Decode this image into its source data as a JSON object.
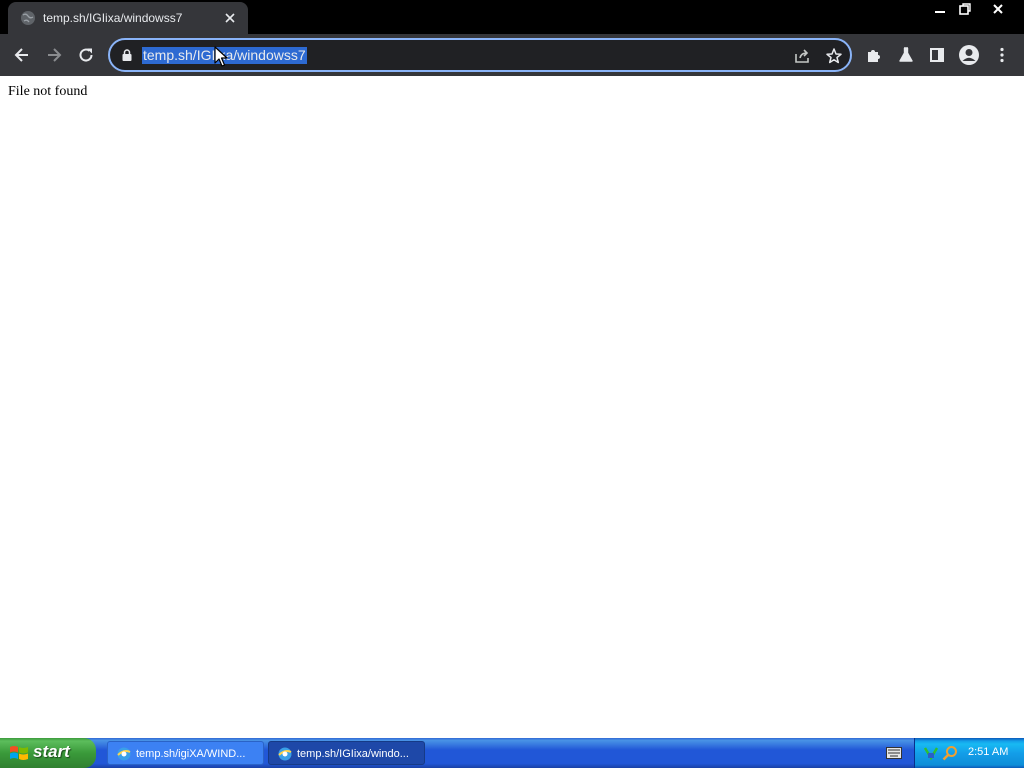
{
  "browser": {
    "tab": {
      "title": "temp.sh/IGIixa/windowss7"
    },
    "address_bar": {
      "url": "temp.sh/IGIixa/windowss7"
    },
    "icons": [
      "globe-icon",
      "close-icon",
      "minimize-icon",
      "restore-icon",
      "window-close-icon",
      "back-icon",
      "forward-icon",
      "reload-icon",
      "lock-icon",
      "share-icon",
      "star-icon",
      "extensions-icon",
      "labs-icon",
      "side-panel-icon",
      "profile-icon",
      "menu-icon"
    ],
    "accent_color": "#8ab4f8",
    "selection_color": "#2d6ad2"
  },
  "page": {
    "message": "File not found"
  },
  "taskbar": {
    "start_label": "start",
    "tasks": [
      {
        "label": "temp.sh/igiXA/WIND..."
      },
      {
        "label": "temp.sh/IGIixa/windo..."
      }
    ],
    "clock": "2:51 AM"
  }
}
